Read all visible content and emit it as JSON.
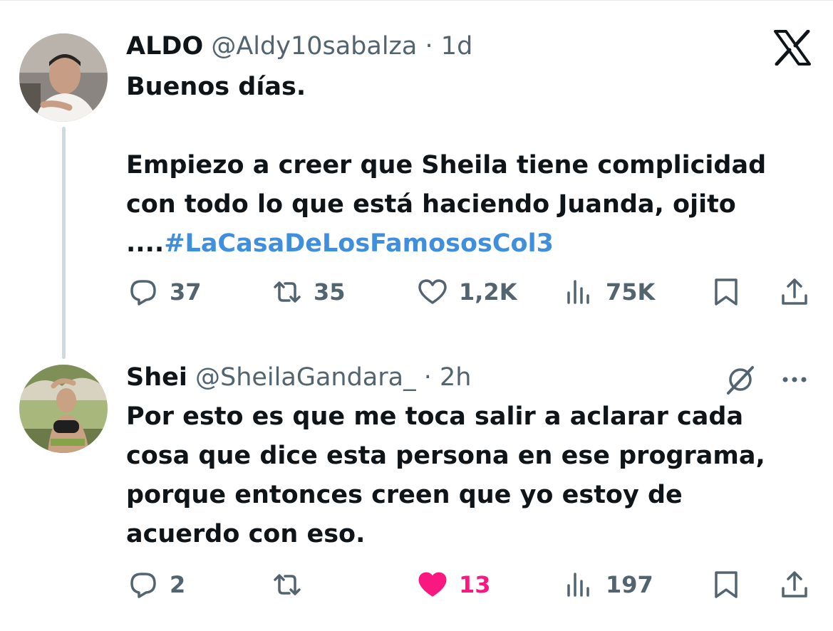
{
  "tweet1": {
    "name": "ALDO",
    "handle": "@Aldy10sabalza",
    "separator": "·",
    "time": "1d",
    "lines": [
      "Buenos días.",
      "",
      "Empiezo a creer que Sheila tiene complicidad",
      "con todo lo que está haciendo Juanda, ojito"
    ],
    "hashtag_prefix": "....",
    "hashtag": "#LaCasaDeLosFamososCol3",
    "replies": "37",
    "retweets": "35",
    "likes": "1,2K",
    "views": "75K"
  },
  "tweet2": {
    "name": "Shei",
    "handle": "@SheilaGandara_",
    "separator": "·",
    "time": "2h",
    "lines": [
      "Por esto es que me toca salir a aclarar cada",
      "cosa que dice esta persona en ese programa,",
      "porque entonces creen que yo estoy de",
      "acuerdo con eso."
    ],
    "replies": "2",
    "retweets": "",
    "likes": "13",
    "views": "197",
    "liked": true
  },
  "icons": {
    "logo": "x-logo-icon",
    "reply": "reply-icon",
    "retweet": "retweet-icon",
    "like": "heart-icon",
    "views": "views-icon",
    "bookmark": "bookmark-icon",
    "share": "share-icon",
    "grok": "grok-icon",
    "more": "more-icon"
  },
  "colors": {
    "text": "#0f1419",
    "muted": "#536471",
    "hashtag": "#3f8fdc",
    "like_active": "#f91880",
    "thread_line": "#cfd9de"
  }
}
